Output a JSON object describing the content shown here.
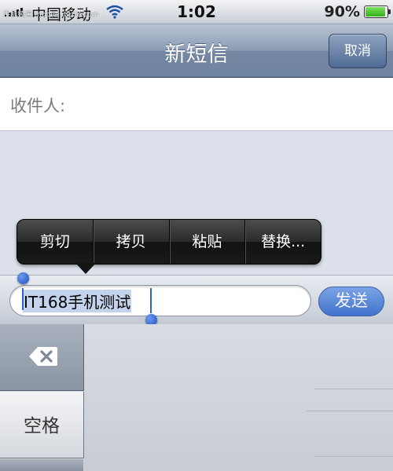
{
  "status_bar": {
    "carrier": "中国移动",
    "watermark": "手机频道 mobile.it168.com",
    "time": "1:02",
    "battery_percent": "90%",
    "battery_level": 0.9,
    "signal_icon": "signal-bars-icon",
    "wifi_icon": "wifi-icon"
  },
  "nav": {
    "title": "新短信",
    "cancel_label": "取消"
  },
  "recipient": {
    "label": "收件人:"
  },
  "edit_menu": {
    "items": [
      "剪切",
      "拷贝",
      "粘贴",
      "替换..."
    ]
  },
  "compose": {
    "message_text": "IT168手机测试",
    "send_label": "发送"
  },
  "keyboard": {
    "backspace_icon": "backspace-icon",
    "space_label": "空格"
  },
  "colors": {
    "nav_bar": "#7588a3",
    "send_button": "#2b62c9",
    "selection": "#c3d3ec",
    "selection_handle": "#1d52bd"
  }
}
